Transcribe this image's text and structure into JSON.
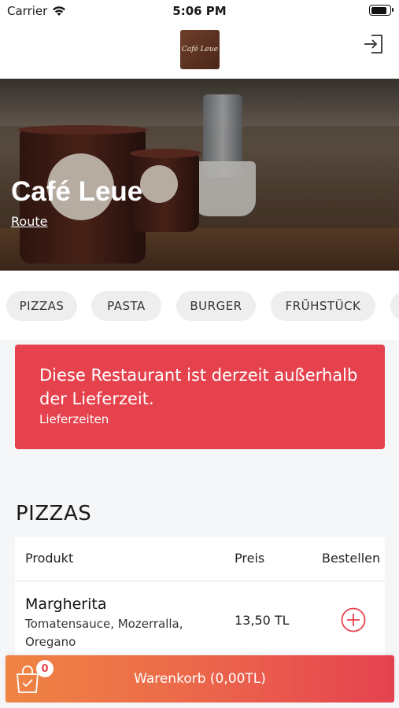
{
  "status_bar": {
    "carrier": "Carrier",
    "time": "5:06 PM",
    "battery_level": 0.9
  },
  "header": {
    "logo_text": "Café Leue"
  },
  "restaurant": {
    "name": "Café Leue",
    "route_label": "Route"
  },
  "categories": [
    "PIZZAS",
    "PASTA",
    "BURGER",
    "FRÜHSTÜCK"
  ],
  "alert": {
    "title": "Diese Restaurant ist derzeit außerhalb der Lieferzeit.",
    "link": "Lieferzeiten",
    "color": "#e5424e"
  },
  "menu": {
    "section_title": "PIZZAS",
    "columns": {
      "product": "Produkt",
      "price": "Preis",
      "order": "Bestellen"
    },
    "items": [
      {
        "name": "Margherita",
        "description": "Tomatensauce, Mozerralla, Oregano",
        "price": "13,50 TL"
      }
    ]
  },
  "cart": {
    "count": "0",
    "label": "Warenkorb (0,00TL)"
  },
  "colors": {
    "accent": "#e5424e",
    "accent_orange": "#ef8443"
  },
  "icons": [
    "wifi-icon",
    "battery-icon",
    "login-icon",
    "add-circle-icon",
    "shopping-bag-icon"
  ]
}
